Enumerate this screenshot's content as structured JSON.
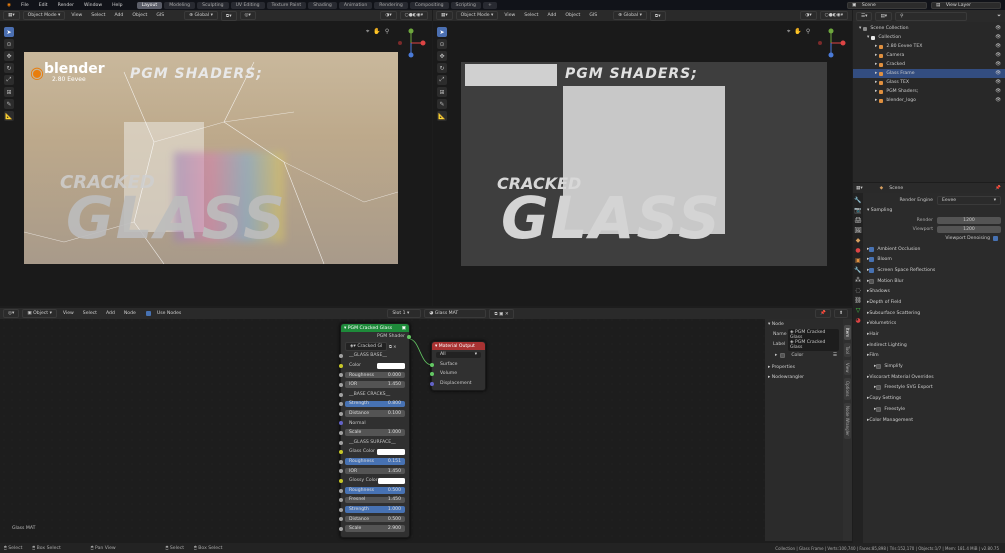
{
  "menubar": {
    "items": [
      "File",
      "Edit",
      "Render",
      "Window",
      "Help"
    ],
    "workspaces": [
      "Layout",
      "Modeling",
      "Sculpting",
      "UV Editing",
      "Texture Paint",
      "Shading",
      "Animation",
      "Rendering",
      "Compositing",
      "Scripting"
    ],
    "active_workspace": "Layout",
    "add_tab": "+",
    "scene": "Scene",
    "view_layer": "View Layer"
  },
  "viewport_left": {
    "mode": "Object Mode",
    "menus": [
      "View",
      "Select",
      "Add",
      "Object",
      "GIS"
    ],
    "orientation": "Global"
  },
  "viewport_right": {
    "mode": "Object Mode",
    "menus": [
      "View",
      "Select",
      "Add",
      "Object",
      "GIS"
    ],
    "orientation": "Global"
  },
  "render_preview": {
    "logo_text": "blender",
    "logo_sub": "2.80 Eevee",
    "pgm": "PGM SHADERS;",
    "cracked": "CRACKED",
    "glass": "GLASS"
  },
  "solid_preview": {
    "pgm": "PGM SHADERS;",
    "cracked": "CRACKED",
    "glass": "GLASS"
  },
  "outliner": {
    "search_placeholder": "",
    "rows": [
      {
        "label": "Scene Collection",
        "indent": 0,
        "color": "#8a8a8a"
      },
      {
        "label": "Collection",
        "indent": 1,
        "color": "#e8e8e8"
      },
      {
        "label": "2.80 Eevee TEX",
        "indent": 2,
        "color": "#e0903f"
      },
      {
        "label": "Camera",
        "indent": 2,
        "color": "#e0903f"
      },
      {
        "label": "Cracked",
        "indent": 2,
        "color": "#e0903f"
      },
      {
        "label": "Glass Frame",
        "indent": 2,
        "color": "#e0903f",
        "selected": true
      },
      {
        "label": "Glass TEX",
        "indent": 2,
        "color": "#e0903f"
      },
      {
        "label": "PGM Shaders;",
        "indent": 2,
        "color": "#e0903f"
      },
      {
        "label": "blender_logo",
        "indent": 2,
        "color": "#e0903f"
      }
    ]
  },
  "properties": {
    "scene": "Scene",
    "render_engine_label": "Render Engine",
    "render_engine": "Eevee",
    "sampling": "Sampling",
    "render_label": "Render",
    "render_value": "1200",
    "viewport_label": "Viewport",
    "viewport_value": "1200",
    "viewport_denoising": "Viewport Denoising",
    "panels": [
      {
        "label": "Ambient Occlusion",
        "check": true
      },
      {
        "label": "Bloom",
        "check": true
      },
      {
        "label": "Screen Space Reflections",
        "check": true
      },
      {
        "label": "Motion Blur",
        "check": false
      },
      {
        "label": "Shadows"
      },
      {
        "label": "Depth of Field"
      },
      {
        "label": "Subsurface Scattering"
      },
      {
        "label": "Volumetrics"
      },
      {
        "label": "Hair"
      },
      {
        "label": "Indirect Lighting"
      },
      {
        "label": "Film"
      },
      {
        "label": "Simplify",
        "check": false,
        "sub": true
      },
      {
        "label": "Viscorart Material Overrides"
      },
      {
        "label": "Freestyle SVG Export",
        "check": false,
        "sub": true
      },
      {
        "label": "Copy Settings"
      },
      {
        "label": "Freestyle",
        "check": false,
        "sub": true
      },
      {
        "label": "Color Management"
      }
    ]
  },
  "node_editor": {
    "type": "Object",
    "menus": [
      "View",
      "Select",
      "Add",
      "Node"
    ],
    "use_nodes": "Use Nodes",
    "slot": "Slot 1",
    "material": "Glass MAT",
    "bottom_label": "Glass MAT"
  },
  "group_node": {
    "title": "PGM Cracked Glass",
    "output": "PGM Shader",
    "datablock": "Cracked Gl",
    "rows": [
      {
        "type": "label",
        "text": "__GLASS BASE__"
      },
      {
        "type": "color",
        "text": "Color"
      },
      {
        "type": "field",
        "text": "Roughness",
        "value": "0.000"
      },
      {
        "type": "field",
        "text": "IOR",
        "value": "1.450"
      },
      {
        "type": "label",
        "text": "__BASE CRACKS__"
      },
      {
        "type": "field",
        "text": "Strength",
        "value": "0.800",
        "blue": true
      },
      {
        "type": "field",
        "text": "Distance",
        "value": "0.100"
      },
      {
        "type": "label",
        "text": "Normal"
      },
      {
        "type": "field",
        "text": "Scale",
        "value": "1.000"
      },
      {
        "type": "label",
        "text": "__GLASS SURFACE__"
      },
      {
        "type": "color",
        "text": "Glass Color"
      },
      {
        "type": "field",
        "text": "Roughness",
        "value": "0.151",
        "blue": true
      },
      {
        "type": "field",
        "text": "IOR",
        "value": "1.450"
      },
      {
        "type": "color",
        "text": "Glossy Color"
      },
      {
        "type": "field",
        "text": "Roughness",
        "value": "0.500",
        "blue": true
      },
      {
        "type": "field",
        "text": "Fresnel",
        "value": "1.450"
      },
      {
        "type": "field",
        "text": "Strength",
        "value": "1.000",
        "blue": true
      },
      {
        "type": "field",
        "text": "Distance",
        "value": "0.500"
      },
      {
        "type": "field",
        "text": "Scale",
        "value": "2.900"
      }
    ]
  },
  "output_node": {
    "title": "Material Output",
    "target": "All",
    "inputs": [
      "Surface",
      "Volume",
      "Displacement"
    ]
  },
  "sidebar": {
    "node_panel": "Node",
    "name_label": "Name",
    "name_value": "PGM Cracked Glass",
    "label_label": "Label",
    "label_value": "PGM Cracked Glass",
    "color": "Color",
    "properties": "Properties",
    "nodewrangler": "Nodewrangler",
    "tabs": [
      "Item",
      "Tool",
      "View",
      "Options",
      "Node Wrangler"
    ]
  },
  "statusbar": {
    "left": [
      "Select",
      "Box Select",
      "Pan View",
      "Select",
      "Box Select"
    ],
    "right": "Collection | Glass Frame | Verts:100,740 | Faces:85,898 | Tris:152,170 | Objects:1/7 | Mem: 181.4 MiB | v2.80.75"
  },
  "colors": {
    "accent": "#4772b3",
    "header": "#2a2a2a",
    "node_green": "#1e8a3a",
    "node_red": "#a83232"
  }
}
